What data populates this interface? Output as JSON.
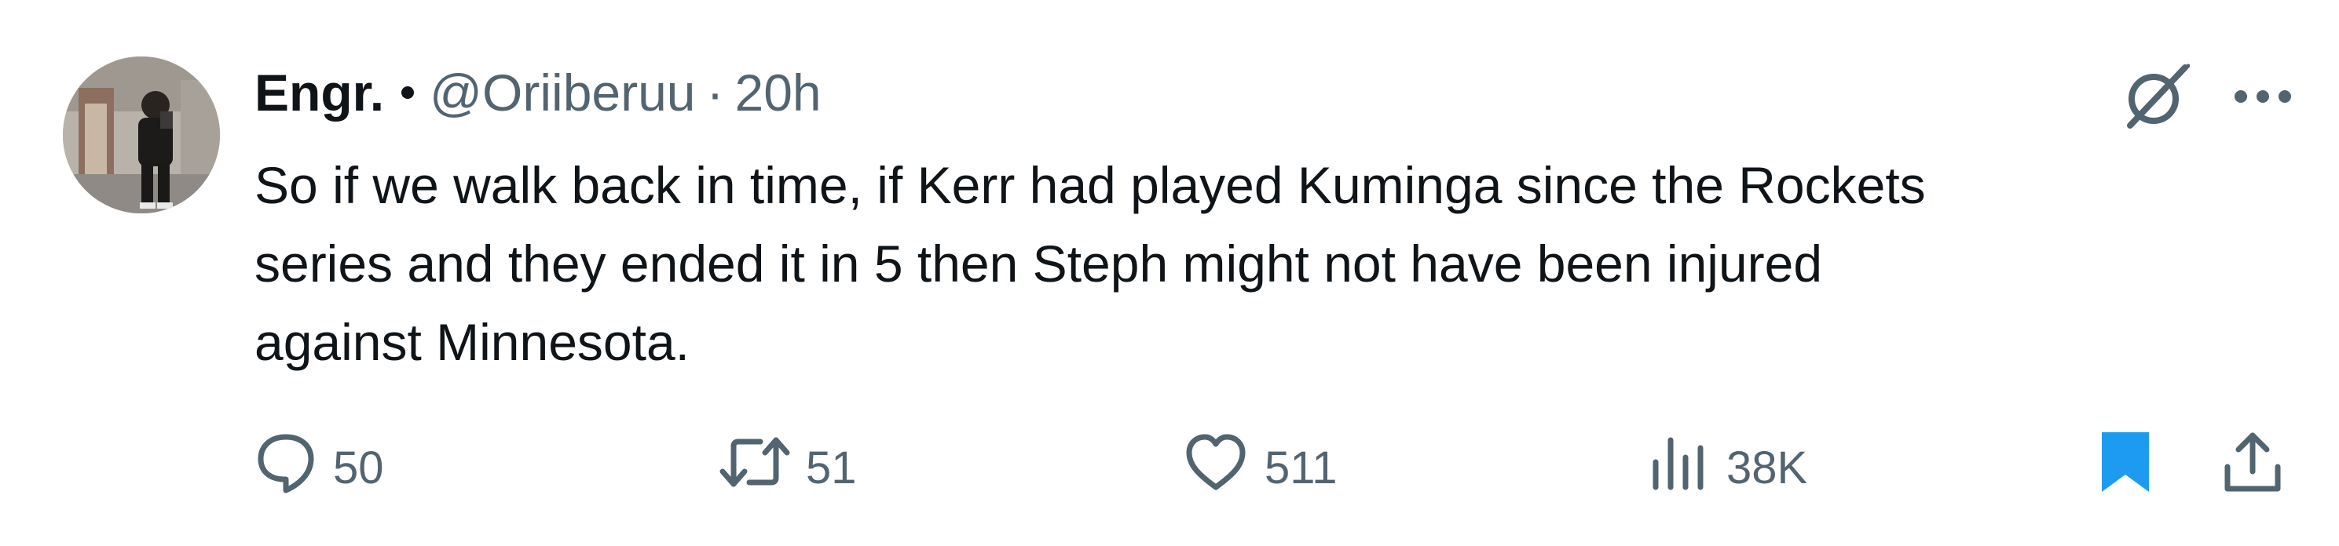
{
  "tweet": {
    "display_name": "Engr.",
    "handle": "@Oriiberuu",
    "separator": "·",
    "time": "20h",
    "text": "So if we walk back in time, if Kerr had played Kuminga since the Rockets\nseries and they ended it in 5 then Steph might not have been injured\nagainst Minnesota.",
    "icons": {
      "grok": "grok-slash-icon",
      "more": "more-dots-icon"
    },
    "actions": {
      "replies": {
        "icon": "reply-icon",
        "count": "50"
      },
      "reposts": {
        "icon": "repost-icon",
        "count": "51"
      },
      "likes": {
        "icon": "heart-icon",
        "count": "511"
      },
      "views": {
        "icon": "views-chart-icon",
        "count": "38K"
      },
      "bookmark": {
        "icon": "bookmark-icon",
        "active": true
      },
      "share": {
        "icon": "share-icon"
      }
    }
  },
  "colors": {
    "text_primary": "#0f1419",
    "text_secondary": "#536471",
    "accent": "#1d9bf0"
  }
}
